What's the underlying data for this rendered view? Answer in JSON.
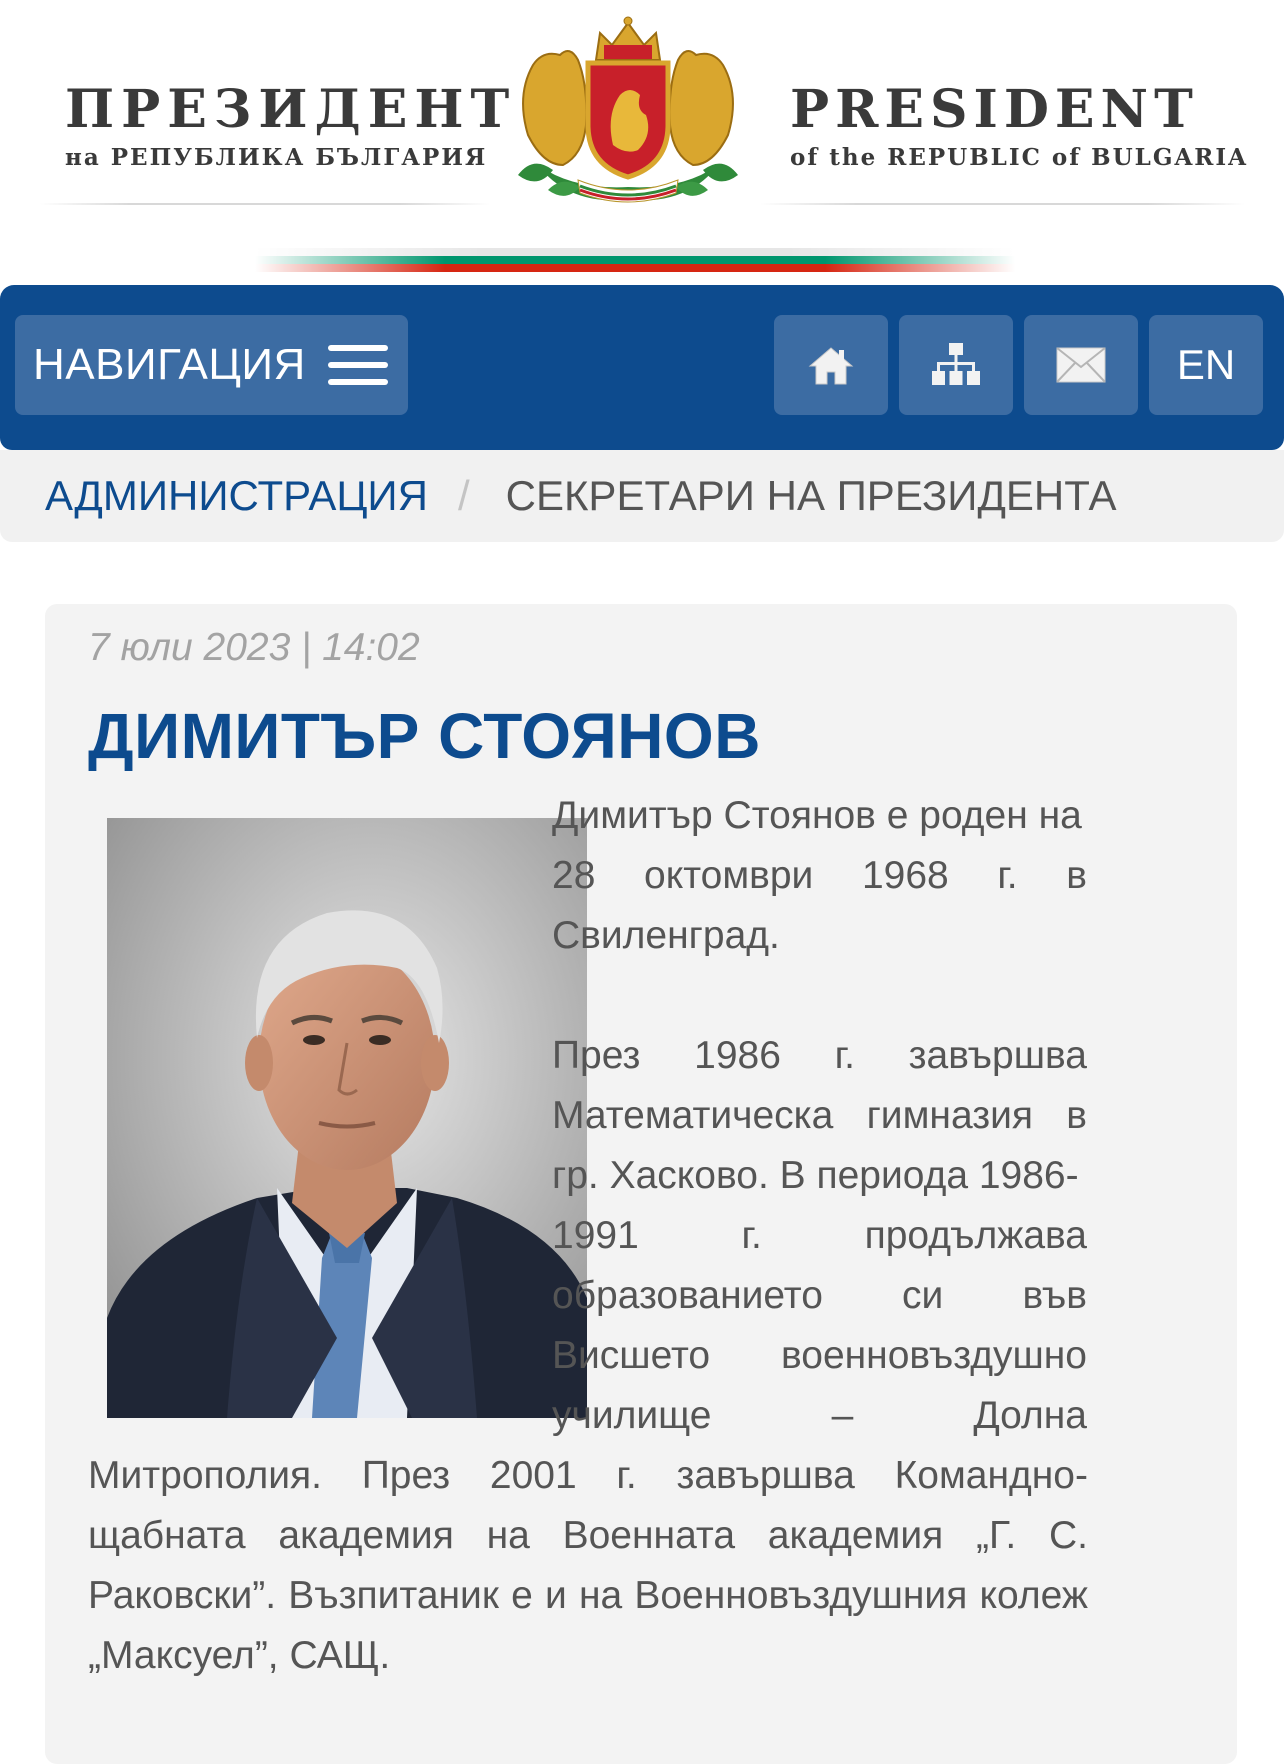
{
  "header": {
    "bg_title": "ПРЕЗИДЕНТ",
    "bg_subtitle": "на РЕПУБЛИКА БЪЛГАРИЯ",
    "en_title": "PRESIDENT",
    "en_subtitle": "of the REPUBLIC of BULGARIA",
    "emblem_icon": "coat-of-arms-icon",
    "flag_colors": [
      "#ffffff",
      "#00966e",
      "#d62612"
    ]
  },
  "nav": {
    "toggle_label": "НАВИГАЦИЯ",
    "toggle_icon": "hamburger-icon",
    "buttons": [
      {
        "icon": "home-icon"
      },
      {
        "icon": "sitemap-icon"
      },
      {
        "icon": "mail-icon"
      }
    ],
    "lang_label": "EN",
    "bar_color": "#0d4b8e",
    "button_color": "#3c6ca3"
  },
  "breadcrumb": {
    "parent": "АДМИНИСТРАЦИЯ",
    "separator": "/",
    "current": "СЕКРЕТАРИ НА ПРЕЗИДЕНТА"
  },
  "article": {
    "date": "7 юли 2023 | 14:02",
    "title": "ДИМИТЪР СТОЯНОВ",
    "photo_icon": "portrait-photo",
    "paragraph1_lines": [
      [
        "Димитър Стоянов е роден на"
      ],
      [
        "28",
        "октомври",
        "1968",
        "г.",
        "в"
      ],
      [
        "Свиленград."
      ]
    ],
    "paragraph2_lines": [
      [
        "През",
        "1986",
        "г.",
        "завършва"
      ],
      [
        "Математическа",
        "гимназия",
        "в"
      ],
      [
        "гр. Хасково. В периода 1986-"
      ],
      [
        "1991",
        "г.",
        "продължава"
      ],
      [
        "образованието",
        "си",
        "във"
      ],
      [
        "Висшето",
        "военновъздушно"
      ],
      [
        "училище",
        "–",
        "Долна"
      ],
      [
        "Митрополия.",
        "През",
        "2001",
        "г.",
        "завършва",
        "Командно-"
      ],
      [
        "щабната",
        "академия",
        "на",
        "Военната",
        "академия",
        "„Г.",
        "С."
      ],
      [
        "Раковски”.",
        "Възпитаник",
        "е",
        "и",
        "на",
        "Военновъздушния",
        "колеж"
      ],
      [
        "„Максуел”, САЩ."
      ]
    ]
  }
}
